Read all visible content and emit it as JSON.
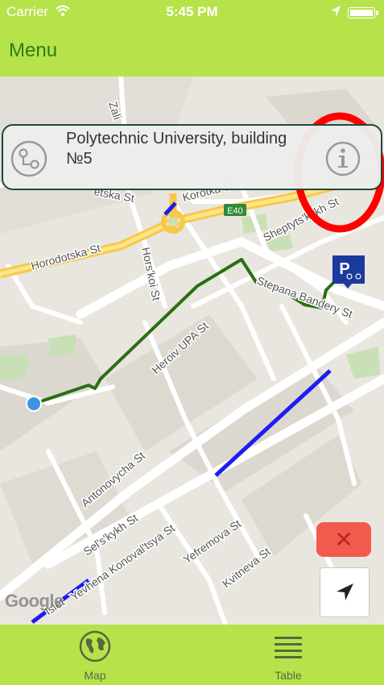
{
  "status_bar": {
    "carrier": "Carrier",
    "time": "5:45 PM"
  },
  "nav": {
    "menu_label": "Menu"
  },
  "info_card": {
    "title": "Polytechnic University, building №5"
  },
  "map": {
    "labels": {
      "zali": "Zali",
      "korotka": "Korotka St",
      "eska": "etska St",
      "e40": "E40",
      "sheptyts": "Sheptyts'kykh St",
      "horodotska": "Horodotska St",
      "horskoi": "Hors'koi St",
      "stepana": "Stepana Bandery St",
      "heroiv": "Heroiv UPA St",
      "antonovycha": "Antonovycha St",
      "selskykh": "Sel's'kykh St",
      "yevhena": "Yevhena Konoval'tsya St",
      "yefremova": "Yefremova St",
      "kvitneva": "Kvitneva St",
      "isle": "Islet"
    },
    "google_logo": "Google"
  },
  "buttons": {
    "cancel": "✕"
  },
  "tabs": [
    {
      "label": "Map",
      "icon": "globe-icon"
    },
    {
      "label": "Table",
      "icon": "list-icon"
    }
  ],
  "colors": {
    "accent": "#b6e34a",
    "route": "#2a6f12",
    "highlight": "#1a1af0",
    "alert": "#ff0000"
  }
}
